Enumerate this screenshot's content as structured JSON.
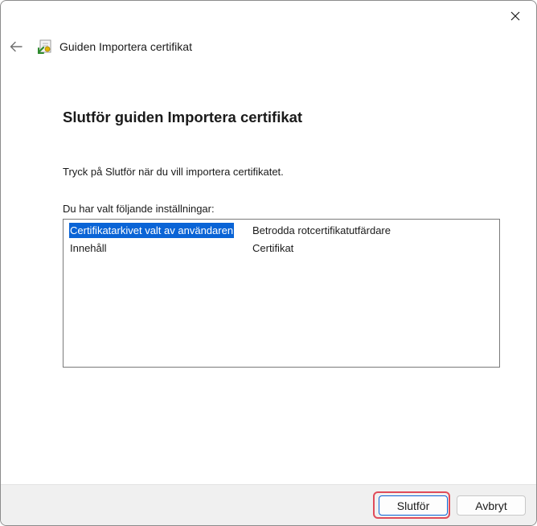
{
  "window": {
    "close_icon": "close-icon"
  },
  "nav": {
    "back_icon": "back-arrow-icon",
    "wizard_icon": "certificate-wizard-icon",
    "title": "Guiden Importera certifikat"
  },
  "main": {
    "heading": "Slutför guiden Importera certifikat",
    "instruction": "Tryck på Slutför när du vill importera certifikatet.",
    "settings_label": "Du har valt följande inställningar:",
    "settings": [
      {
        "key": "Certifikatarkivet valt av användaren",
        "value": "Betrodda rotcertifikatutfärdare",
        "selected": true
      },
      {
        "key": "Innehåll",
        "value": "Certifikat",
        "selected": false
      }
    ]
  },
  "footer": {
    "finish_label": "Slutför",
    "cancel_label": "Avbryt"
  },
  "colors": {
    "selection": "#0a64d6",
    "focus_highlight": "#e04c5a",
    "footer_bg": "#f0f0f0"
  }
}
